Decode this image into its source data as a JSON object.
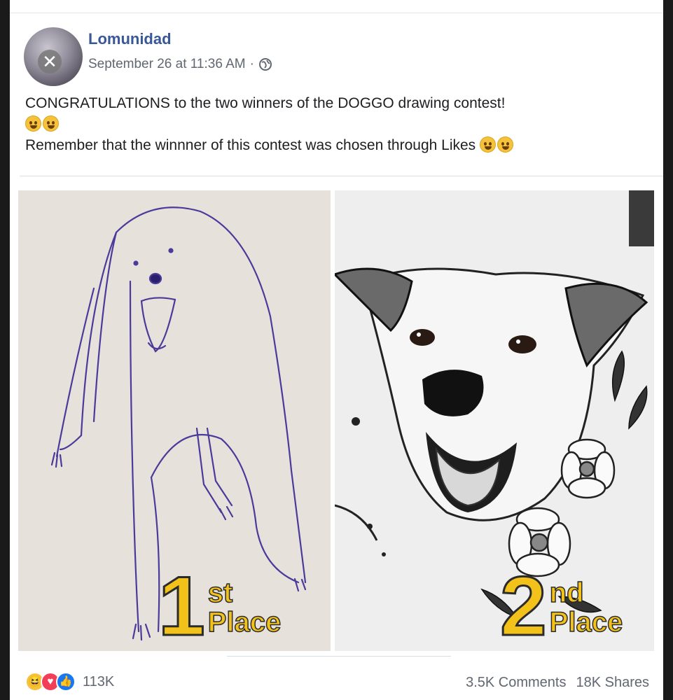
{
  "post": {
    "page_name": "Lomunidad",
    "timestamp": "September 26 at 11:36 AM",
    "separator": "·",
    "privacy_icon": "globe-icon",
    "text_line1": "CONGRATULATIONS to the two winners of the DOGGO drawing contest!",
    "text_line2": "Remember that the winnner of this contest was chosen through Likes"
  },
  "images": [
    {
      "place_number": "1",
      "place_suffix": "st",
      "place_word": "Place"
    },
    {
      "place_number": "2",
      "place_suffix": "nd",
      "place_word": "Place"
    }
  ],
  "footer": {
    "reaction_icons": [
      "haha-icon",
      "love-icon",
      "like-icon"
    ],
    "reaction_count": "113K",
    "comments": "3.5K Comments",
    "shares": "18K Shares"
  },
  "colors": {
    "page_name": "#385898",
    "label_yellow": "#f2c21b",
    "like_blue": "#1877f2",
    "love_red": "#f33e58"
  }
}
